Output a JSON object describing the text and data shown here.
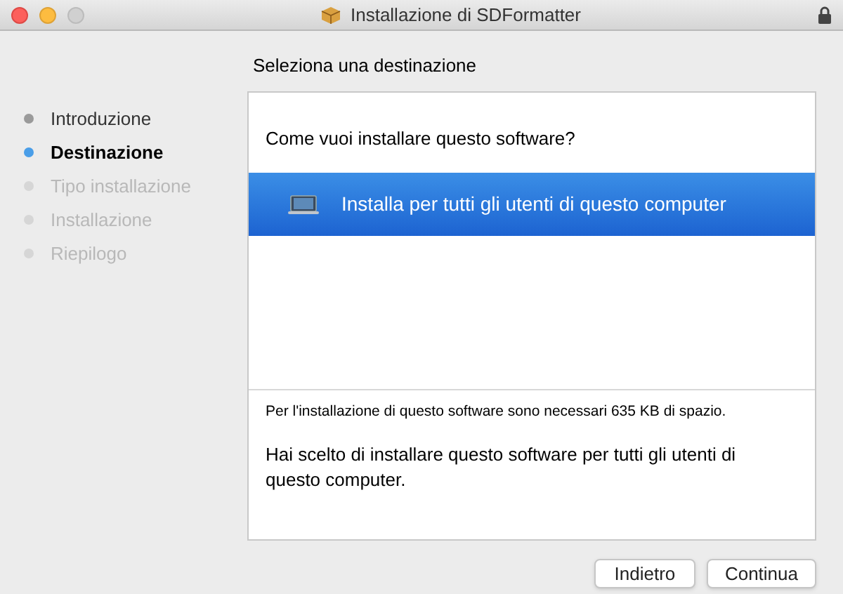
{
  "window": {
    "title": "Installazione di SDFormatter"
  },
  "steps": [
    {
      "label": "Introduzione",
      "selected": false,
      "completed": true
    },
    {
      "label": "Destinazione",
      "selected": true,
      "completed": false
    },
    {
      "label": "Tipo installazione",
      "selected": false,
      "completed": false
    },
    {
      "label": "Installazione",
      "selected": false,
      "completed": false
    },
    {
      "label": "Riepilogo",
      "selected": false,
      "completed": false
    }
  ],
  "heading": "Seleziona una destinazione",
  "question": "Come vuoi installare questo software?",
  "options": [
    {
      "label": "Installa per tutti gli utenti di questo computer",
      "selected": true
    }
  ],
  "space_note": "Per l'installazione di questo software sono necessari 635 KB di spazio.",
  "description": "Hai scelto di installare questo software per tutti gli utenti di questo computer.",
  "buttons": [
    "Indietro",
    "Continua"
  ]
}
